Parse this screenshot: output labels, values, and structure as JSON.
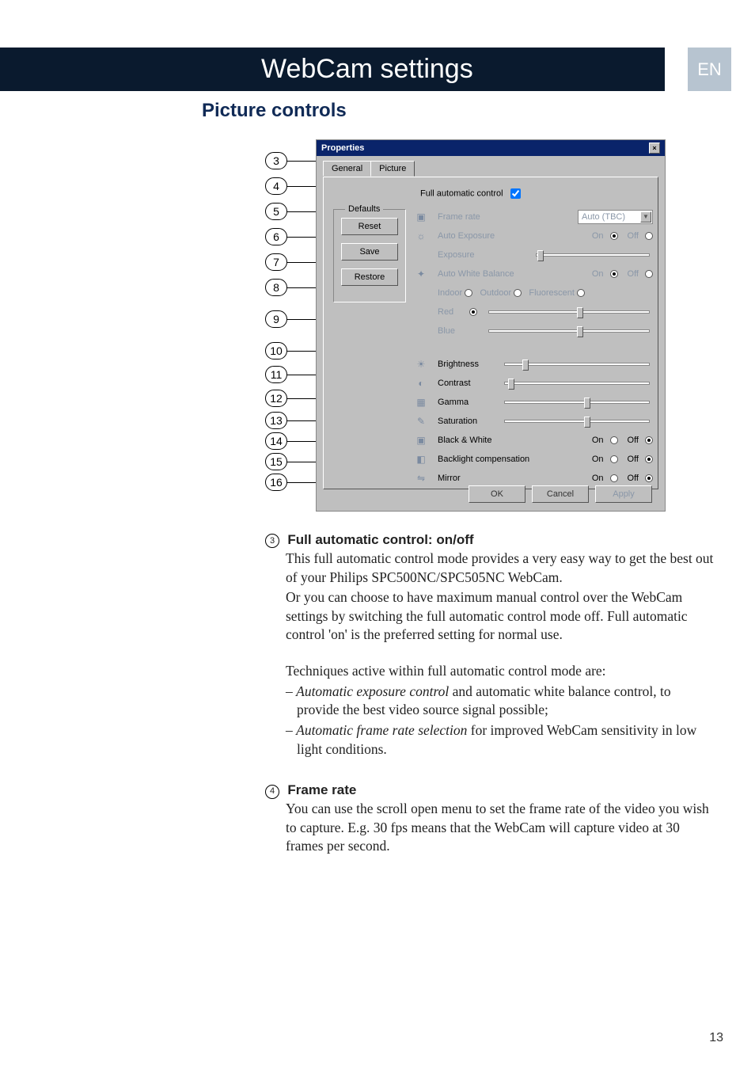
{
  "header": {
    "title": "WebCam settings",
    "lang": "EN"
  },
  "section_title": "Picture controls",
  "page_number": "13",
  "dialog": {
    "title": "Properties",
    "tabs": {
      "general": "General",
      "picture": "Picture"
    },
    "defaults_legend": "Defaults",
    "buttons": {
      "reset": "Reset",
      "save": "Save",
      "restore": "Restore",
      "ok": "OK",
      "cancel": "Cancel",
      "apply": "Apply"
    },
    "full_auto_label": "Full automatic control",
    "frame_rate": {
      "label": "Frame rate",
      "value": "Auto (TBC)"
    },
    "auto_exposure": {
      "label": "Auto Exposure",
      "on": "On",
      "off": "Off"
    },
    "exposure": {
      "label": "Exposure"
    },
    "awb": {
      "label": "Auto White Balance",
      "on": "On",
      "off": "Off",
      "indoor": "Indoor",
      "outdoor": "Outdoor",
      "fluorescent": "Fluorescent"
    },
    "red": "Red",
    "blue": "Blue",
    "brightness": "Brightness",
    "contrast": "Contrast",
    "gamma": "Gamma",
    "saturation": "Saturation",
    "bw": {
      "label": "Black & White",
      "on": "On",
      "off": "Off"
    },
    "backlight": {
      "label": "Backlight compensation",
      "on": "On",
      "off": "Off"
    },
    "mirror": {
      "label": "Mirror",
      "on": "On",
      "off": "Off"
    }
  },
  "callouts": {
    "c3": "3",
    "c4": "4",
    "c5": "5",
    "c6": "6",
    "c7": "7",
    "c8": "8",
    "c9": "9",
    "c10": "10",
    "c11": "11",
    "c12": "12",
    "c13": "13",
    "c14": "14",
    "c15": "15",
    "c16": "16"
  },
  "body": {
    "s3": {
      "num": "3",
      "heading": "Full automatic control: on/off",
      "p1": "This full automatic control mode provides a very easy way to get the best out of your Philips SPC500NC/SPC505NC WebCam.",
      "p2": "Or you can choose to have maximum manual control over the WebCam settings by switching the full automatic control mode off. Full automatic control 'on' is the preferred setting for normal use.",
      "p3": "Techniques active within full automatic control mode are:",
      "b1a": "Automatic exposure control",
      "b1b": " and automatic white balance control, to provide the best video source signal possible;",
      "b2a": "Automatic frame rate selection",
      "b2b": " for improved WebCam sensitivity in low light conditions."
    },
    "s4": {
      "num": "4",
      "heading": "Frame rate",
      "p1": "You can use the scroll open menu to set the frame rate of the video you wish to capture. E.g. 30 fps means that the WebCam will capture video at 30 frames per second."
    }
  }
}
